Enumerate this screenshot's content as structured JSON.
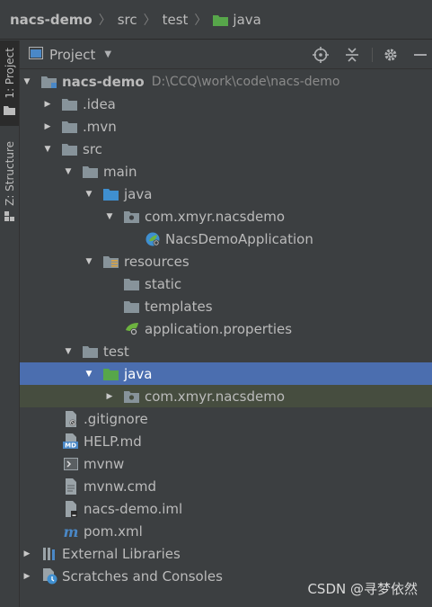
{
  "breadcrumb": [
    "nacs-demo",
    "src",
    "test",
    "java"
  ],
  "tool_windows": {
    "project_tab": "1: Project",
    "structure_tab": "Z: Structure"
  },
  "panel": {
    "view_selector": "Project"
  },
  "tree": [
    {
      "label": "nacs-demo",
      "path": "D:\\CCQ\\work\\code\\nacs-demo",
      "icon": "module-folder-icon",
      "expanded": true
    },
    {
      "label": ".idea",
      "icon": "folder-icon",
      "expanded": false
    },
    {
      "label": ".mvn",
      "icon": "folder-icon",
      "expanded": false
    },
    {
      "label": "src",
      "icon": "folder-icon",
      "expanded": true
    },
    {
      "label": "main",
      "icon": "folder-icon",
      "expanded": true
    },
    {
      "label": "java",
      "icon": "source-folder-icon",
      "expanded": true
    },
    {
      "label": "com.xmyr.nacsdemo",
      "icon": "package-icon",
      "expanded": true
    },
    {
      "label": "NacsDemoApplication",
      "icon": "spring-boot-class-icon"
    },
    {
      "label": "resources",
      "icon": "resources-folder-icon",
      "expanded": true
    },
    {
      "label": "static",
      "icon": "folder-icon"
    },
    {
      "label": "templates",
      "icon": "folder-icon"
    },
    {
      "label": "application.properties",
      "icon": "spring-properties-icon"
    },
    {
      "label": "test",
      "icon": "folder-icon",
      "expanded": true
    },
    {
      "label": "java",
      "icon": "test-source-folder-icon",
      "expanded": true,
      "selected": true
    },
    {
      "label": "com.xmyr.nacsdemo",
      "icon": "package-icon",
      "expanded": false
    },
    {
      "label": ".gitignore",
      "icon": "ignore-file-icon"
    },
    {
      "label": "HELP.md",
      "icon": "markdown-file-icon"
    },
    {
      "label": "mvnw",
      "icon": "shell-script-icon"
    },
    {
      "label": "mvnw.cmd",
      "icon": "text-file-icon"
    },
    {
      "label": "nacs-demo.iml",
      "icon": "iml-file-icon"
    },
    {
      "label": "pom.xml",
      "icon": "maven-file-icon"
    },
    {
      "label": "External Libraries",
      "icon": "libraries-icon",
      "expanded": false
    },
    {
      "label": "Scratches and Consoles",
      "icon": "scratches-icon",
      "expanded": false
    }
  ],
  "watermark": "CSDN @寻梦依然",
  "colors": {
    "background": "#3c3f41",
    "selection": "#4b6eaf",
    "inactive_selection": "#464d3f",
    "folder": "#87939a",
    "source_folder": "#3f8fd0",
    "test_folder": "#57a64a"
  }
}
